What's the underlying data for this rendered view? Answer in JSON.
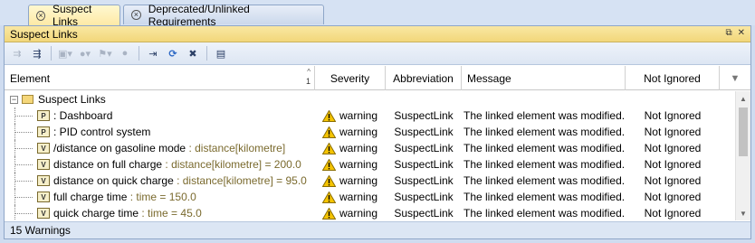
{
  "tabs": [
    {
      "label": "Suspect Links",
      "active": true
    },
    {
      "label": "Deprecated/Unlinked Requirements",
      "active": false
    }
  ],
  "panel": {
    "title": "Suspect Links"
  },
  "columns": {
    "element": "Element",
    "sort_indicator": "1",
    "severity": "Severity",
    "abbreviation": "Abbreviation",
    "message": "Message",
    "not_ignored": "Not Ignored"
  },
  "tree_root": "Suspect Links",
  "rows": [
    {
      "icon": "P",
      "name": ": Dashboard",
      "type": "",
      "severity": "warning",
      "abbr": "SuspectLink",
      "message": "The linked element was modified.",
      "ignored": "Not Ignored"
    },
    {
      "icon": "P",
      "name": ": PID control system",
      "type": "",
      "severity": "warning",
      "abbr": "SuspectLink",
      "message": "The linked element was modified.",
      "ignored": "Not Ignored"
    },
    {
      "icon": "V",
      "name": "/distance on gasoline mode",
      "type": " : distance[kilometre]",
      "severity": "warning",
      "abbr": "SuspectLink",
      "message": "The linked element was modified.",
      "ignored": "Not Ignored"
    },
    {
      "icon": "V",
      "name": "distance on full charge",
      "type": " : distance[kilometre] = 200.0",
      "severity": "warning",
      "abbr": "SuspectLink",
      "message": "The linked element was modified.",
      "ignored": "Not Ignored"
    },
    {
      "icon": "V",
      "name": "distance on quick charge",
      "type": " : distance[kilometre] = 95.0",
      "severity": "warning",
      "abbr": "SuspectLink",
      "message": "The linked element was modified.",
      "ignored": "Not Ignored"
    },
    {
      "icon": "V",
      "name": "full charge time",
      "type": " : time = 150.0",
      "severity": "warning",
      "abbr": "SuspectLink",
      "message": "The linked element was modified.",
      "ignored": "Not Ignored"
    },
    {
      "icon": "V",
      "name": "quick charge time",
      "type": " : time = 45.0",
      "severity": "warning",
      "abbr": "SuspectLink",
      "message": "The linked element was modified.",
      "ignored": "Not Ignored"
    }
  ],
  "status": "15 Warnings",
  "colors": {
    "title_bar": "#f2d77a",
    "warning": "#f5c400",
    "type_text": "#7a6a2e"
  }
}
